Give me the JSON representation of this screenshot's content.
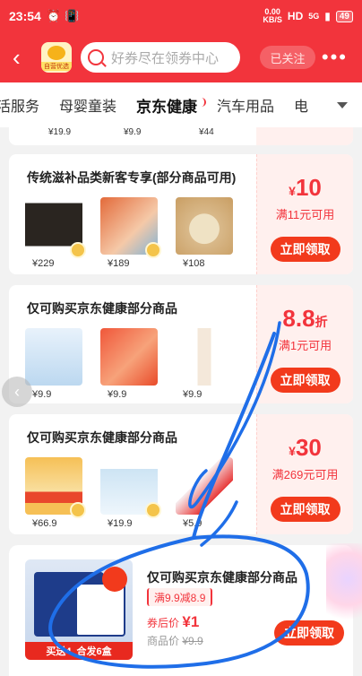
{
  "status_bar": {
    "time": "23:54",
    "speed_value": "0.00",
    "speed_unit": "KB/S",
    "network": "HD",
    "signal": "5G",
    "battery": "49"
  },
  "nav": {
    "shop_label": "自营优选",
    "search_placeholder": "好券尽在领券中心",
    "follow_label": "已关注",
    "more_icon": "more-dots-icon"
  },
  "tabs": [
    {
      "label": "活服务"
    },
    {
      "label": "母婴童装"
    },
    {
      "label": "京东健康",
      "active": true
    },
    {
      "label": "汽车用品"
    },
    {
      "label": "电"
    }
  ],
  "partial_prices": [
    "¥19.9",
    "¥9.9",
    "¥44"
  ],
  "coupons": [
    {
      "title": "传统滋补品类新客专享(部分商品可用)",
      "products": [
        {
          "price": "¥229",
          "color": "#2a2520"
        },
        {
          "price": "¥189",
          "color": "#e36a3a"
        },
        {
          "price": "¥108",
          "color": "#d9b98a"
        }
      ],
      "amount_currency": "¥",
      "amount": "10",
      "amount_suffix": "",
      "condition": "满11元可用",
      "button": "立即领取"
    },
    {
      "title": "仅可购买京东健康部分商品",
      "products": [
        {
          "price": "¥9.9",
          "color": "#bcd8f0"
        },
        {
          "price": "¥9.9",
          "color": "#f0573a"
        },
        {
          "price": "¥9.9",
          "color": "#f4e8da"
        }
      ],
      "amount_currency": "",
      "amount": "8.8",
      "amount_suffix": "折",
      "condition": "满1元可用",
      "button": "立即领取"
    },
    {
      "title": "仅可购买京东健康部分商品",
      "products": [
        {
          "price": "¥66.9",
          "color": "#f6c056"
        },
        {
          "price": "¥19.9",
          "color": "#cde4f4"
        },
        {
          "price": "¥5.9",
          "color": "#f7eef0"
        }
      ],
      "amount_currency": "¥",
      "amount": "30",
      "amount_suffix": "",
      "condition": "满269元可用",
      "button": "立即领取"
    }
  ],
  "featured": {
    "title": "仅可购买京东健康部分商品",
    "deal": "满9.9减8.9",
    "after_label": "券后价",
    "after_price": "¥1",
    "orig_label": "商品价",
    "orig_price": "¥9.9",
    "ribbon_a": "买送4",
    "ribbon_b": "合发6盒",
    "button": "立即领取"
  }
}
